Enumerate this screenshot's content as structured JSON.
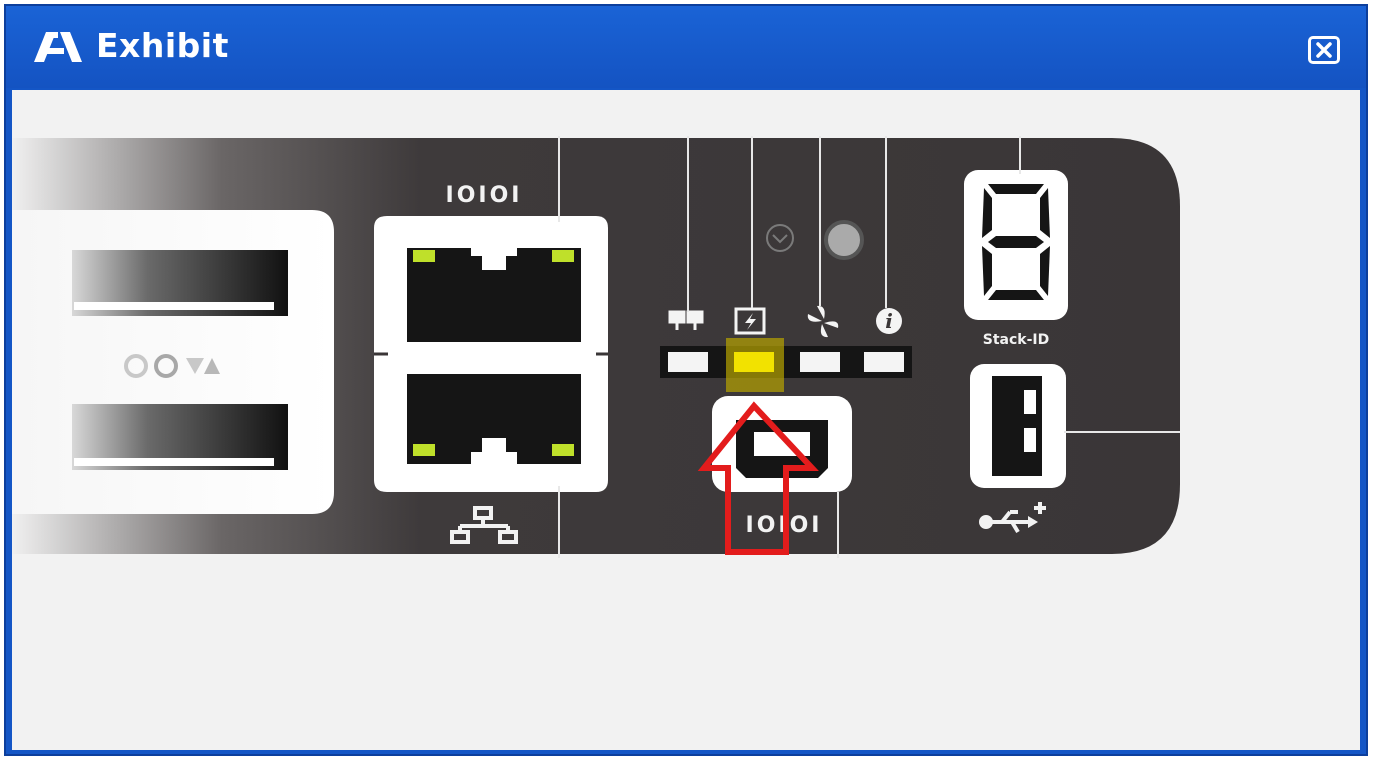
{
  "window": {
    "title": "Exhibit",
    "title_icon": "exhibit-icon",
    "close_icon": "close-icon",
    "accent": "#1456c6"
  },
  "panel": {
    "serial_top_label": "IOIOI",
    "serial_bottom_label": "IOIOI",
    "stack_label": "Stack-ID",
    "stack_display": "8",
    "status_leds": [
      {
        "name": "system",
        "icon": "system-icon",
        "color": "#f4f4f4"
      },
      {
        "name": "power",
        "icon": "power-icon",
        "color": "#f2e200"
      },
      {
        "name": "fan",
        "icon": "fan-icon",
        "color": "#f4f4f4"
      },
      {
        "name": "info",
        "icon": "info-icon",
        "color": "#f4f4f4"
      }
    ],
    "highlight_color": "#e31c1c",
    "port_led_color": "#bfe02a"
  }
}
